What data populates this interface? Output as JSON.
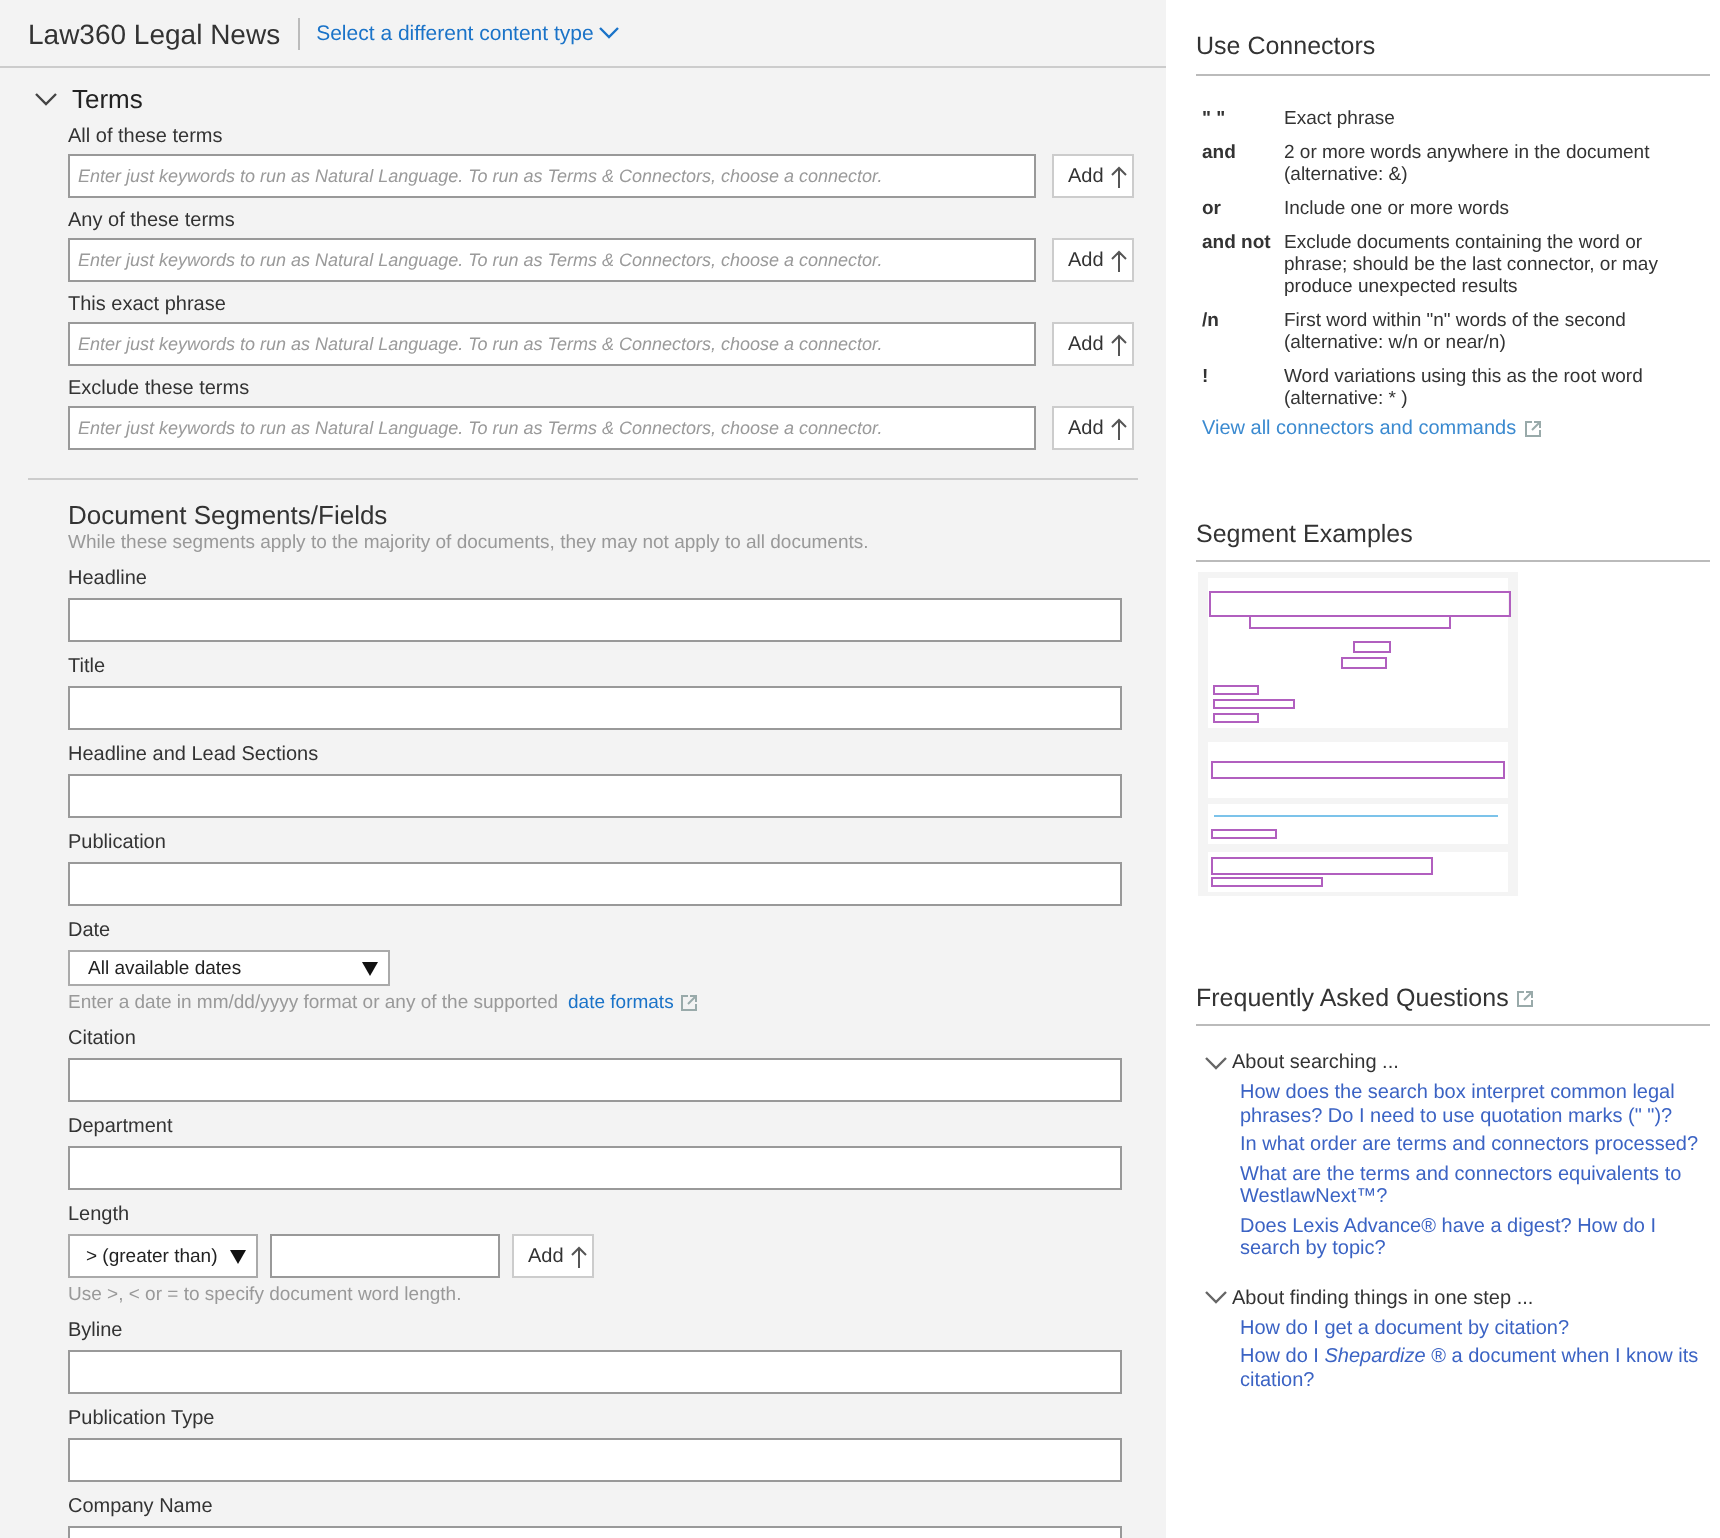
{
  "header": {
    "title": "Law360 Legal News",
    "content_type_link": "Select a different content type"
  },
  "terms": {
    "heading": "Terms",
    "expanded": true,
    "rows": [
      {
        "label": "All of these terms",
        "placeholder": "Enter just keywords to run as Natural Language. To run as Terms & Connectors, choose a connector.",
        "button": "Add"
      },
      {
        "label": "Any of these terms",
        "placeholder": "Enter just keywords to run as Natural Language. To run as Terms & Connectors, choose a connector.",
        "button": "Add"
      },
      {
        "label": "This exact phrase",
        "placeholder": "Enter just keywords to run as Natural Language. To run as Terms & Connectors, choose a connector.",
        "button": "Add"
      },
      {
        "label": "Exclude these terms",
        "placeholder": "Enter just keywords to run as Natural Language. To run as Terms & Connectors, choose a connector.",
        "button": "Add"
      }
    ]
  },
  "segments": {
    "heading": "Document Segments/Fields",
    "description": "While these segments apply to the majority of documents, they may not apply to all documents.",
    "fields": [
      {
        "kind": "text",
        "label": "Headline"
      },
      {
        "kind": "text",
        "label": "Title"
      },
      {
        "kind": "text",
        "label": "Headline and Lead Sections"
      },
      {
        "kind": "text",
        "label": "Publication"
      },
      {
        "kind": "date",
        "label": "Date",
        "select": "All available dates",
        "hint": "Enter a date in mm/dd/yyyy format or any of the supported",
        "hint_link": "date formats"
      },
      {
        "kind": "text",
        "label": "Citation"
      },
      {
        "kind": "text",
        "label": "Department"
      },
      {
        "kind": "length",
        "label": "Length",
        "select": "> (greater than)",
        "button": "Add",
        "hint": "Use >, < or = to specify document word length."
      },
      {
        "kind": "text",
        "label": "Byline"
      },
      {
        "kind": "text",
        "label": "Publication Type"
      },
      {
        "kind": "text",
        "label": "Company Name"
      }
    ]
  },
  "connectors": {
    "heading": "Use Connectors",
    "items": [
      {
        "symbol": "\" \"",
        "description": "Exact phrase"
      },
      {
        "symbol": "and",
        "description": "2 or more words anywhere in the document (alternative: &)"
      },
      {
        "symbol": "or",
        "description": "Include one or more words"
      },
      {
        "symbol": "and not",
        "description": "Exclude documents containing the word or phrase; should be the last connector, or may produce unexpected results"
      },
      {
        "symbol": "/n",
        "description": "First word within \"n\" words of the second (alternative: w/n or near/n)"
      },
      {
        "symbol": "!",
        "description": "Word variations using this as the root word (alternative: * )"
      }
    ],
    "link": "View all connectors and commands"
  },
  "segment_examples": {
    "heading": "Segment Examples"
  },
  "faq": {
    "heading": "Frequently Asked Questions",
    "groups": [
      {
        "title": "About searching ...",
        "expanded": true,
        "links": [
          "How does the search box interpret common legal phrases? Do I need to use quotation marks (\" \")?",
          "In what order are terms and connectors processed?",
          "What are the terms and connectors equivalents to WestlawNext™?",
          "Does Lexis Advance® have a digest? How do I search by topic?"
        ]
      },
      {
        "title": "About finding things in one step ...",
        "expanded": true,
        "links": [
          "How do I get a document by citation?",
          "How do I *Shepardize* ® a document when I know its citation?"
        ]
      }
    ]
  }
}
